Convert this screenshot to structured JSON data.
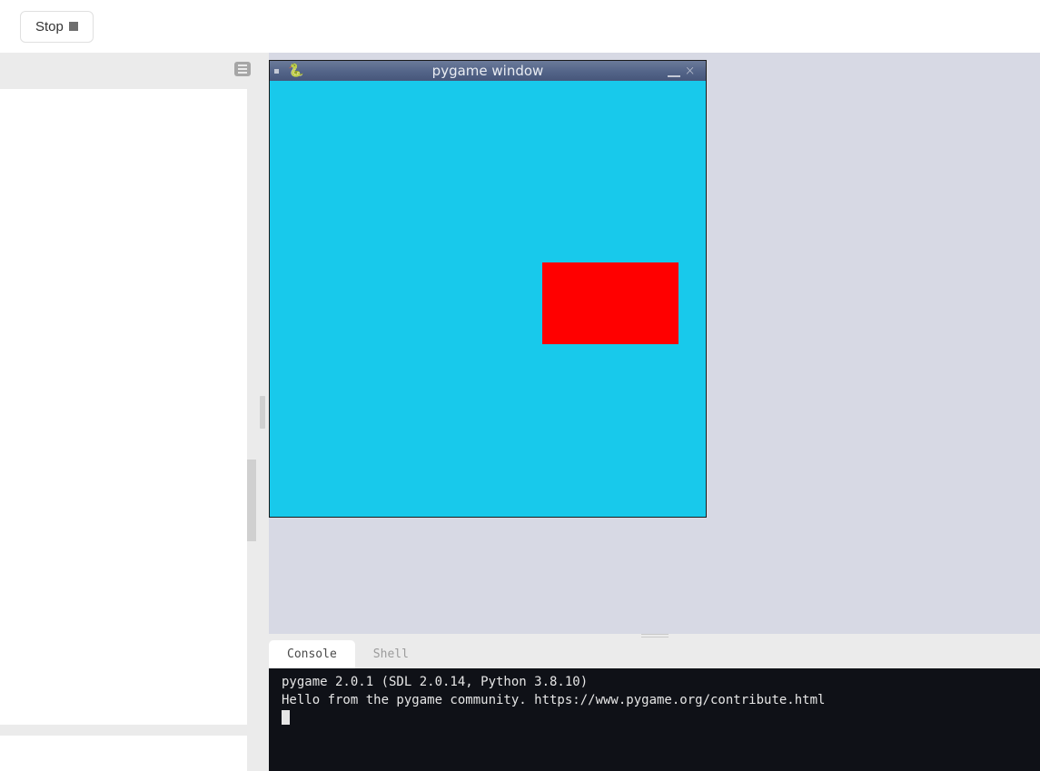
{
  "toolbar": {
    "stop_label": "Stop"
  },
  "pygame": {
    "title": "pygame window",
    "canvas_bg": "#18c9eb",
    "rect_color": "#f00"
  },
  "tabs": {
    "console": "Console",
    "shell": "Shell"
  },
  "console": {
    "line1": "pygame 2.0.1 (SDL 2.0.14, Python 3.8.10)",
    "line2": "Hello from the pygame community. https://www.pygame.org/contribute.html"
  }
}
